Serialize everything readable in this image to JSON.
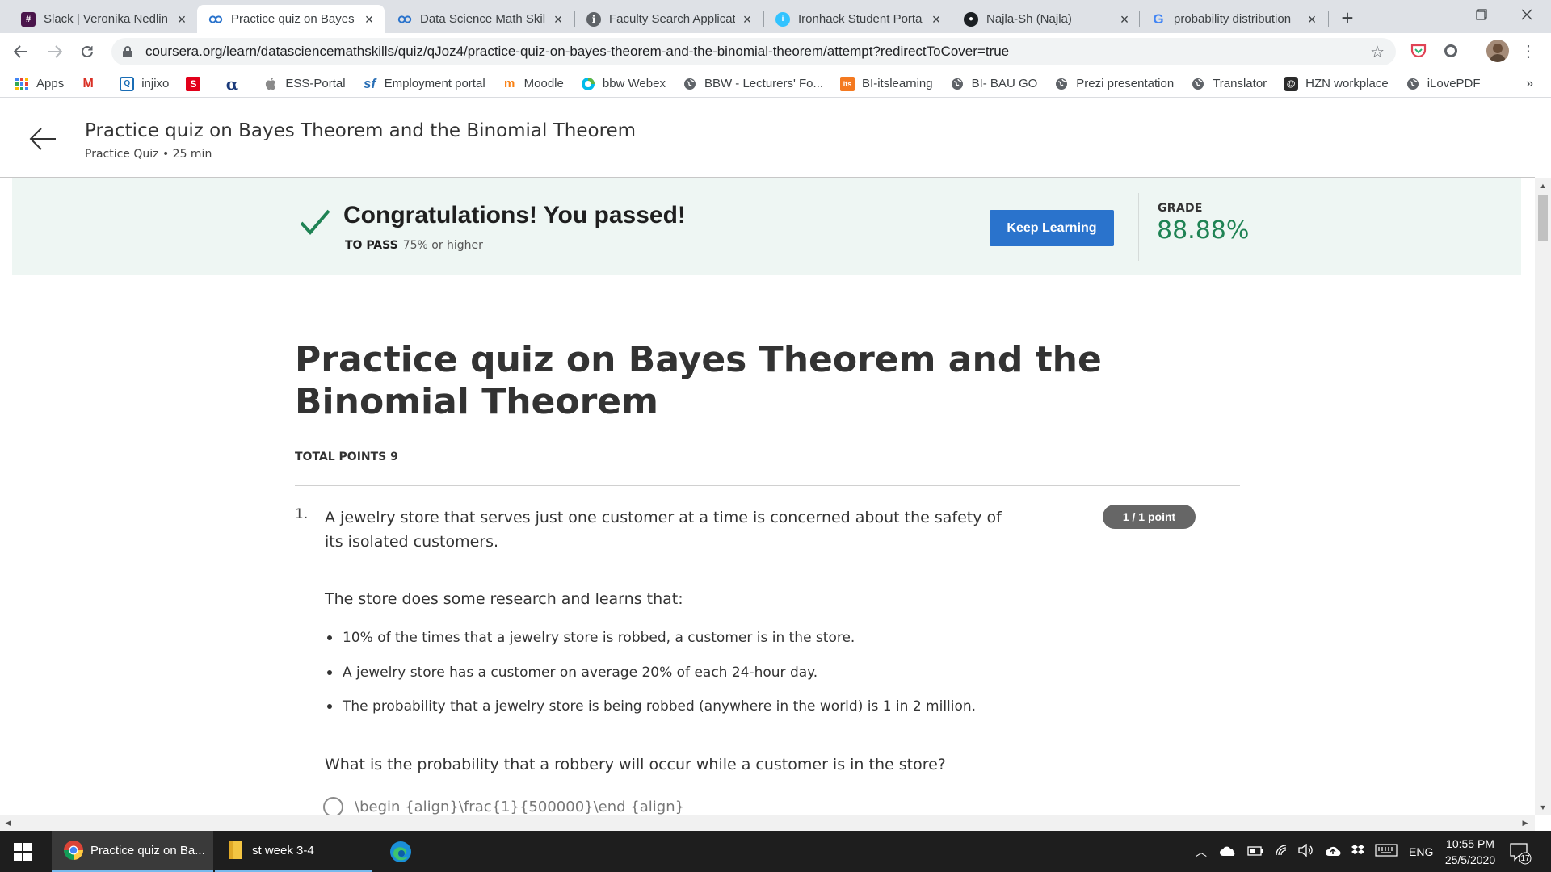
{
  "browser": {
    "tabs": [
      {
        "title": "Slack | Veronika Nedlin",
        "icon": "slack-icon",
        "active": false
      },
      {
        "title": "Practice quiz on Bayes",
        "icon": "coursera-icon",
        "active": true
      },
      {
        "title": "Data Science Math Skil",
        "icon": "coursera-icon",
        "active": false
      },
      {
        "title": "Faculty Search Applicat",
        "icon": "info-icon",
        "active": false
      },
      {
        "title": "Ironhack Student Porta",
        "icon": "ironhack-icon",
        "active": false
      },
      {
        "title": "Najla-Sh (Najla)",
        "icon": "github-icon",
        "active": false
      },
      {
        "title": "probability distribution",
        "icon": "google-icon",
        "active": false
      }
    ],
    "url": "coursera.org/learn/datasciencemathskills/quiz/qJoz4/practice-quiz-on-bayes-theorem-and-the-binomial-theorem/attempt?redirectToCover=true",
    "bookmarks": [
      {
        "label": "Apps",
        "icon": "apps-grid-icon"
      },
      {
        "label": "",
        "icon": "gmail-icon"
      },
      {
        "label": "injixo",
        "icon": "injixo-icon"
      },
      {
        "label": "",
        "icon": "sparkasse-icon"
      },
      {
        "label": "",
        "icon": "alpha-icon"
      },
      {
        "label": "ESS-Portal",
        "icon": "apple-icon"
      },
      {
        "label": "Employment portal",
        "icon": "sf-icon"
      },
      {
        "label": "Moodle",
        "icon": "moodle-icon"
      },
      {
        "label": "bbw Webex",
        "icon": "webex-icon"
      },
      {
        "label": "BBW - Lecturers' Fo...",
        "icon": "globe-icon"
      },
      {
        "label": "BI-itslearning",
        "icon": "its-icon"
      },
      {
        "label": "BI- BAU GO",
        "icon": "globe-icon"
      },
      {
        "label": "Prezi presentation",
        "icon": "globe-icon"
      },
      {
        "label": "Translator",
        "icon": "globe-icon"
      },
      {
        "label": "HZN workplace",
        "icon": "hzn-icon"
      },
      {
        "label": "iLovePDF",
        "icon": "globe-icon"
      }
    ],
    "bookmarks_more": "»"
  },
  "header": {
    "title": "Practice quiz on Bayes Theorem and the Binomial Theorem",
    "subtitle": "Practice Quiz • 25 min"
  },
  "banner": {
    "message": "Congratulations! You passed!",
    "to_pass_label": "TO PASS",
    "to_pass_value": "75% or higher",
    "button_label": "Keep Learning",
    "grade_label": "GRADE",
    "grade_value": "88.88%",
    "accent_color": "#1f8354",
    "button_color": "#2a73cc"
  },
  "quiz": {
    "title": "Practice quiz on Bayes Theorem and the Binomial Theorem",
    "total_points": "TOTAL POINTS 9",
    "question": {
      "number": "1.",
      "text": "A jewelry store that serves just one customer at a time is concerned about the safety of its isolated customers.",
      "points_badge": "1 / 1 point",
      "intro": "The store does some research and learns that:",
      "bullets": [
        "10% of the times that a jewelry store is robbed, a customer is in the store.",
        "A jewelry store has a customer on average 20% of each 24-hour day.",
        "The probability that a jewelry store is being robbed (anywhere in the world) is 1 in 2 million."
      ],
      "ask": "What is the probability that a robbery will occur while a customer is in the store?",
      "option1": "\\begin {align}\\frac{1}{500000}\\end {align}"
    }
  },
  "taskbar": {
    "apps": [
      {
        "label": "Practice quiz on Ba...",
        "icon": "chrome-icon"
      },
      {
        "label": "st week 3-4",
        "icon": "folder-icon"
      },
      {
        "label": "",
        "icon": "edge-icon"
      }
    ],
    "language": "ENG",
    "time": "10:55 PM",
    "date": "25/5/2020",
    "notifications": "17"
  }
}
